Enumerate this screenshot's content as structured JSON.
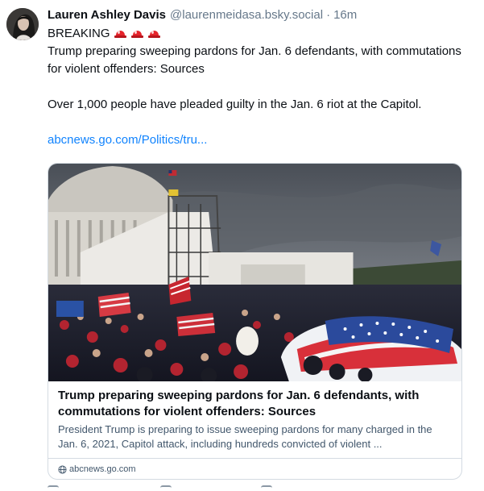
{
  "post": {
    "display_name": "Lauren Ashley Davis",
    "handle": "@laurenmeidasa.bsky.social",
    "separator": "·",
    "time": "16m",
    "breaking_label": "BREAKING",
    "breaking_emoji": "police-car-light-icon",
    "breaking_emoji_count": 3,
    "paragraph_1": "Trump preparing sweeping pardons for Jan. 6 defendants, with commutations for violent offenders: Sources",
    "paragraph_2": "Over 1,000 people have pleaded guilty in the Jan. 6 riot at the Capitol.",
    "link_text": "abcnews.go.com/Politics/tru..."
  },
  "card": {
    "image": "capitol-riot-photo",
    "title": "Trump preparing sweeping pardons for Jan. 6 defendants, with commutations for violent offenders: Sources",
    "description": "President Trump is preparing to issue sweeping pardons for many charged in the Jan. 6, 2021, Capitol attack, including hundreds convicted of violent ...",
    "domain": "abcnews.go.com",
    "domain_icon": "globe-icon"
  },
  "colors": {
    "link": "#1083fe",
    "muted": "#66788a",
    "border": "#d4dbe2",
    "siren_red": "#e5242b"
  }
}
